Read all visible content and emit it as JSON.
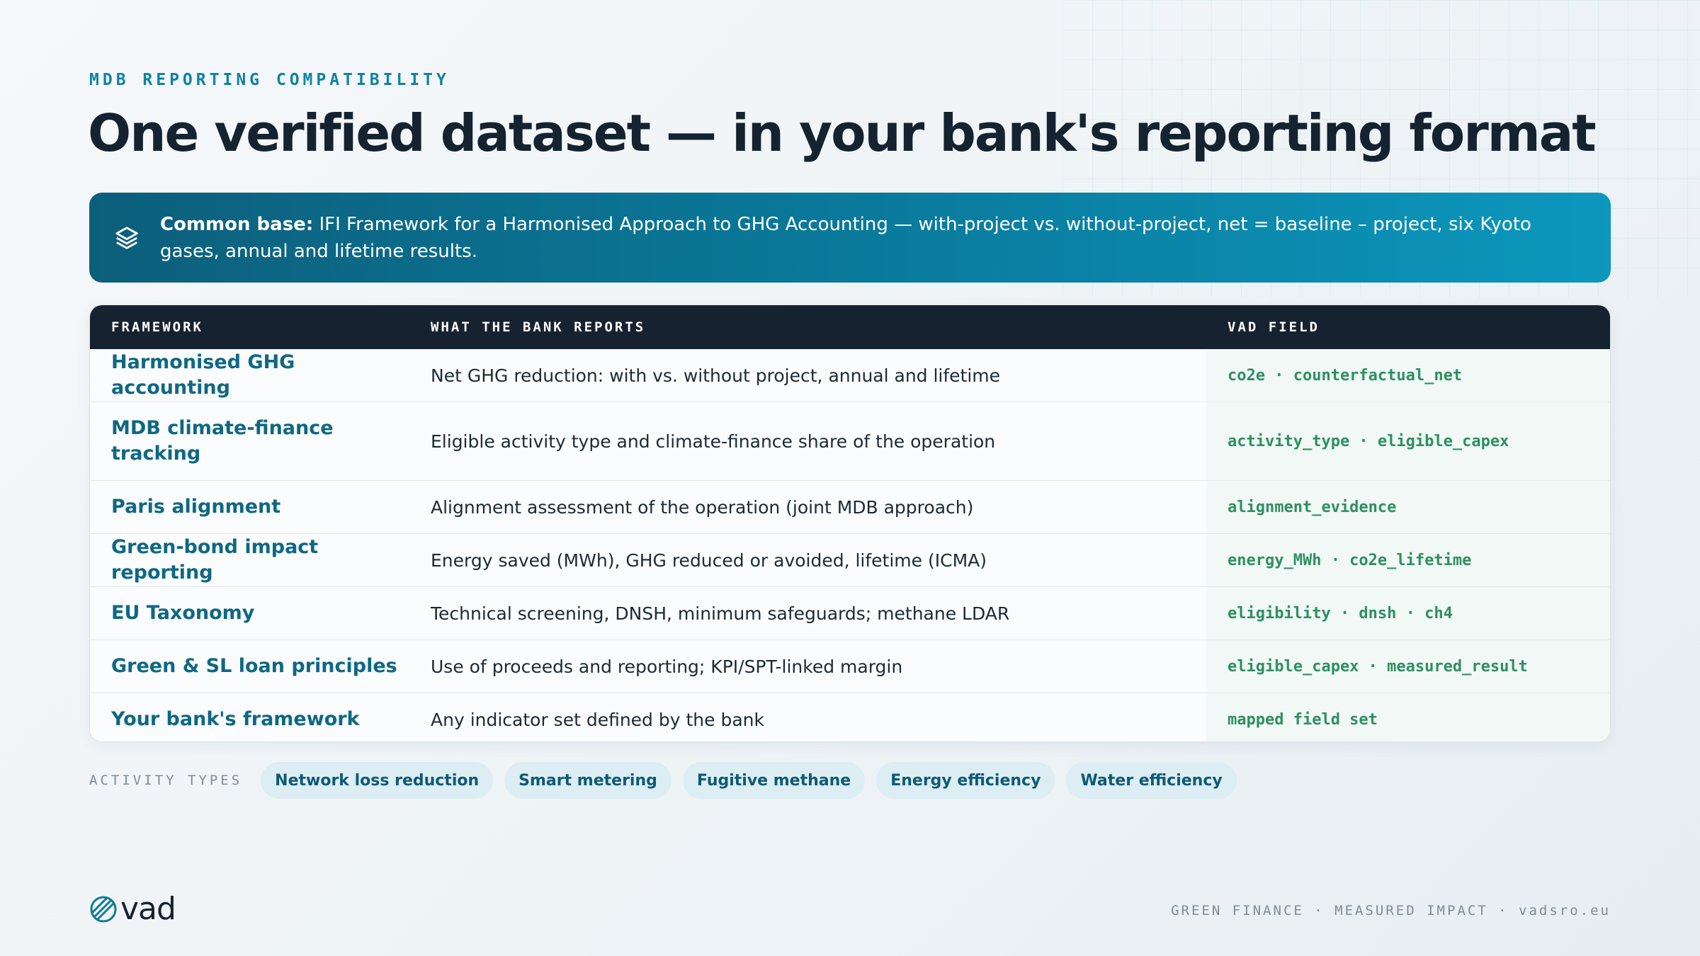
{
  "eyebrow": "MDB REPORTING COMPATIBILITY",
  "title": "One verified dataset — in your bank's reporting format",
  "banner": {
    "icon": "layers-icon",
    "lead": "Common base:",
    "text": " IFI Framework for a Harmonised Approach to GHG Accounting — with-project vs. without-project, net = baseline – project, six Kyoto gases, annual and lifetime results."
  },
  "table": {
    "headers": [
      "FRAMEWORK",
      "WHAT THE BANK REPORTS",
      "VAD FIELD"
    ],
    "rows": [
      {
        "framework": "Harmonised GHG accounting",
        "reports": "Net GHG reduction: with vs. without project, annual and lifetime",
        "field": "co2e · counterfactual_net"
      },
      {
        "framework": "MDB climate-finance tracking",
        "reports": "Eligible activity type and climate-finance share of the operation",
        "field": "activity_type · eligible_capex"
      },
      {
        "framework": "Paris alignment",
        "reports": "Alignment assessment of the operation (joint MDB approach)",
        "field": "alignment_evidence"
      },
      {
        "framework": "Green-bond impact reporting",
        "reports": "Energy saved (MWh), GHG reduced or avoided, lifetime (ICMA)",
        "field": "energy_MWh · co2e_lifetime"
      },
      {
        "framework": "EU Taxonomy",
        "reports": "Technical screening, DNSH, minimum safeguards; methane LDAR",
        "field": "eligibility · dnsh · ch4"
      },
      {
        "framework": "Green & SL loan principles",
        "reports": "Use of proceeds and reporting; KPI/SPT-linked margin",
        "field": "eligible_capex · measured_result"
      },
      {
        "framework": "Your bank's framework",
        "reports": "Any indicator set defined by the bank",
        "field": "mapped field set"
      }
    ]
  },
  "activity": {
    "label": "ACTIVITY TYPES",
    "chips": [
      "Network loss reduction",
      "Smart metering",
      "Fugitive methane",
      "Energy efficiency",
      "Water efficiency"
    ]
  },
  "brand": {
    "logo_icon": "globe-logo-icon",
    "name": "vad"
  },
  "footer": "GREEN FINANCE · MEASURED IMPACT · vadsro.eu",
  "colors": {
    "accent": "#0f83a4",
    "dark": "#172230",
    "field_green": "#2e8f63",
    "framework_teal": "#0e6883"
  }
}
